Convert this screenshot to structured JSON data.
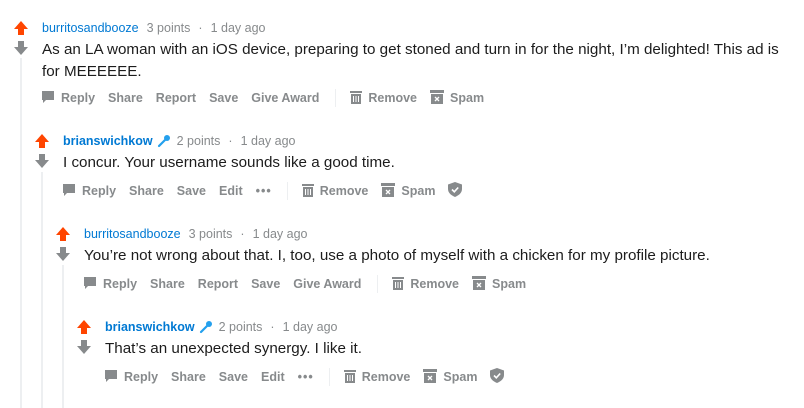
{
  "comments": [
    {
      "author": "burritosandbooze",
      "points": "3 points",
      "sep": "·",
      "time": "1 day ago",
      "body": "As an LA woman with an iOS device, preparing to get stoned and turn in for the night, I’m delighted! This ad is for MEEEEEE.",
      "actions": {
        "reply": "Reply",
        "share": "Share",
        "report": "Report",
        "save": "Save",
        "award": "Give Award",
        "remove": "Remove",
        "spam": "Spam"
      }
    },
    {
      "author": "brianswichkow",
      "points": "2 points",
      "sep": "·",
      "time": "1 day ago",
      "body": "I concur. Your username sounds like a good time.",
      "actions": {
        "reply": "Reply",
        "share": "Share",
        "save": "Save",
        "edit": "Edit",
        "more": "•••",
        "remove": "Remove",
        "spam": "Spam"
      }
    },
    {
      "author": "burritosandbooze",
      "points": "3 points",
      "sep": "·",
      "time": "1 day ago",
      "body": "You’re not wrong about that. I, too, use a photo of myself with a chicken for my profile picture.",
      "actions": {
        "reply": "Reply",
        "share": "Share",
        "report": "Report",
        "save": "Save",
        "award": "Give Award",
        "remove": "Remove",
        "spam": "Spam"
      }
    },
    {
      "author": "brianswichkow",
      "points": "2 points",
      "sep": "·",
      "time": "1 day ago",
      "body": "That’s an unexpected synergy. I like it.",
      "actions": {
        "reply": "Reply",
        "share": "Share",
        "save": "Save",
        "edit": "Edit",
        "more": "•••",
        "remove": "Remove",
        "spam": "Spam"
      }
    }
  ],
  "colors": {
    "upvote": "#ff4500",
    "downvote": "#878a8c",
    "author": "#0079d3",
    "meta": "#878a8c",
    "thread_line": "#edeff1"
  },
  "icons": {
    "upvote": "arrow-up-icon",
    "downvote": "arrow-down-icon",
    "reply": "comment-bubble-icon",
    "remove": "trash-icon",
    "spam": "spam-icon",
    "approve": "shield-icon",
    "mod": "microphone-icon"
  }
}
